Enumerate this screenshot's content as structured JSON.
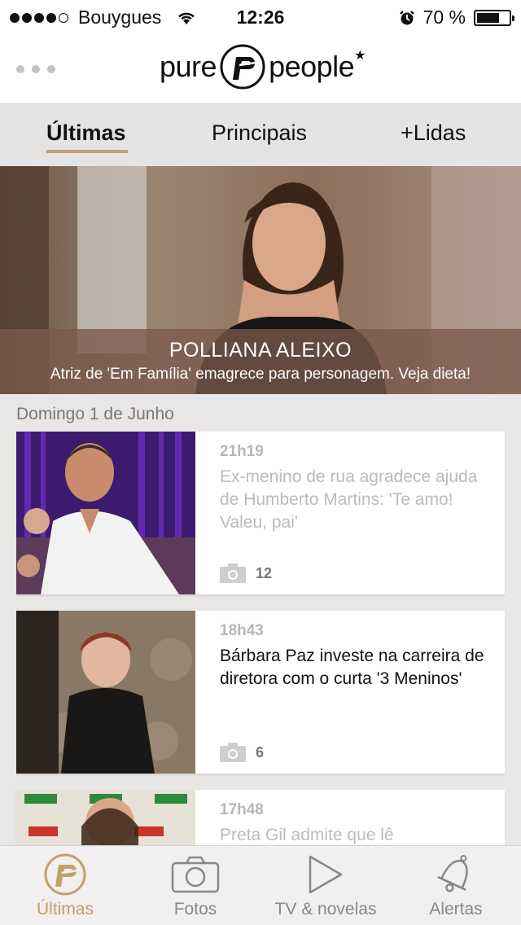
{
  "status_bar": {
    "carrier": "Bouygues",
    "time": "12:26",
    "battery_percent": "70 %",
    "battery_level": 0.7
  },
  "header": {
    "logo_text_left": "pure",
    "logo_text_right": "people",
    "logo_star": "★"
  },
  "tabs": [
    {
      "label": "Últimas",
      "active": true
    },
    {
      "label": "Principais",
      "active": false
    },
    {
      "label": "+Lidas",
      "active": false
    }
  ],
  "hero": {
    "title": "POLLIANA ALEIXO",
    "subtitle": "Atriz de 'Em Família' emagrece para personagem. Veja dieta!"
  },
  "date_label": "Domingo 1 de Junho",
  "articles": [
    {
      "time": "21h19",
      "headline": "Ex-menino de rua agradece ajuda de Humberto Martins: 'Te amo! Valeu, pai'",
      "read": true,
      "photo_count": "12"
    },
    {
      "time": "18h43",
      "headline": "Bárbara Paz investe na carreira de diretora com o curta '3 Meninos'",
      "read": false,
      "photo_count": "6"
    },
    {
      "time": "17h48",
      "headline": "Preta Gil admite que lê",
      "read": true,
      "photo_count": ""
    }
  ],
  "tab_bar": [
    {
      "label": "Últimas",
      "icon": "purepeople-logo-icon",
      "active": true
    },
    {
      "label": "Fotos",
      "icon": "camera-icon",
      "active": false
    },
    {
      "label": "TV & novelas",
      "icon": "play-icon",
      "active": false
    },
    {
      "label": "Alertas",
      "icon": "bell-icon",
      "active": false
    }
  ],
  "colors": {
    "accent": "#c2a06a",
    "read_text": "#bdbaba",
    "background": "#e9e6e6"
  }
}
